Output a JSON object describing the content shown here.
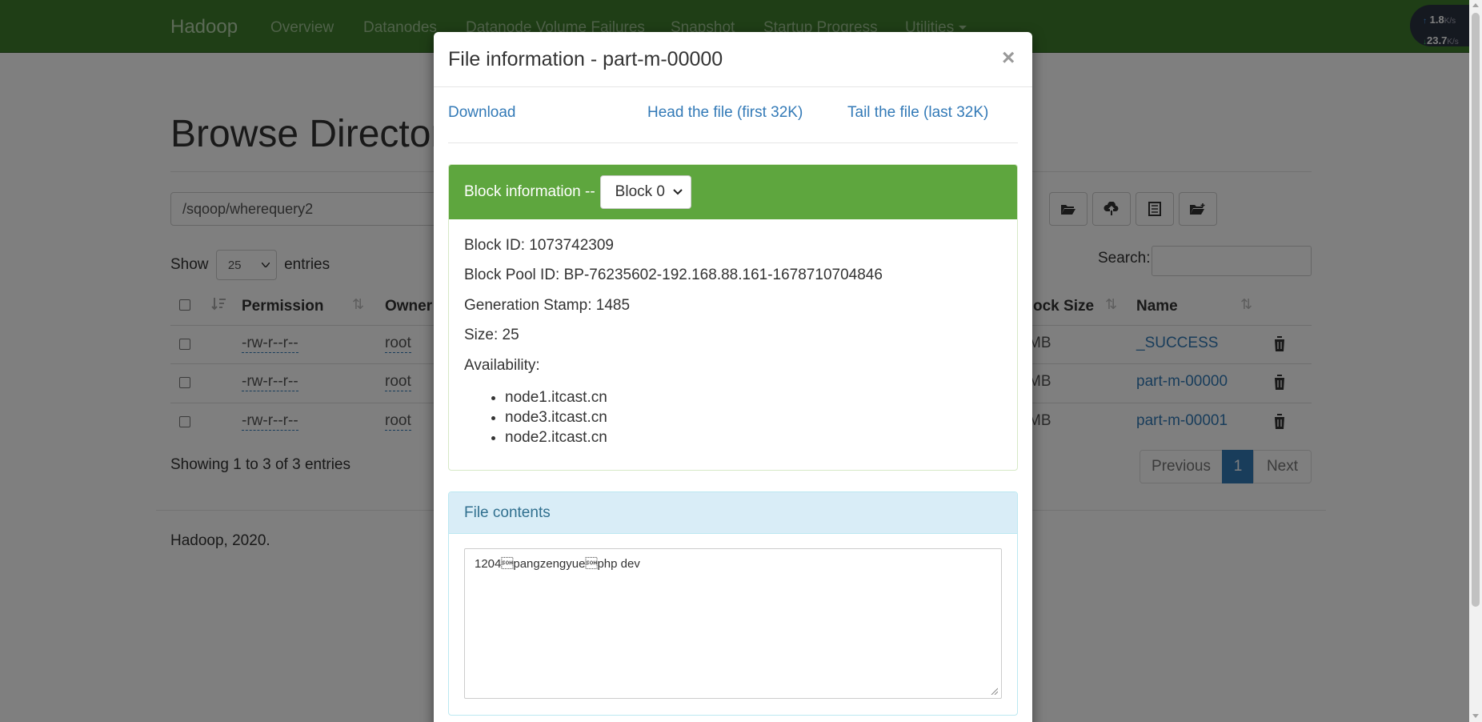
{
  "navbar": {
    "brand": "Hadoop",
    "items": [
      "Overview",
      "Datanodes",
      "Datanode Volume Failures",
      "Snapshot",
      "Startup Progress",
      "Utilities"
    ]
  },
  "netspeed": {
    "up": "1.8",
    "down": "23.7",
    "unit": "K/s"
  },
  "browse": {
    "title": "Browse Directory",
    "path": "/sqoop/wherequery2",
    "show_label": "Show",
    "entries_count": "25",
    "entries_label": "entries",
    "search_label": "Search:",
    "columns": [
      "Permission",
      "Owner",
      "Block Size",
      "Name"
    ],
    "rows": [
      {
        "permission": "-rw-r--r--",
        "owner": "root",
        "block_size": "MB",
        "name": "_SUCCESS"
      },
      {
        "permission": "-rw-r--r--",
        "owner": "root",
        "block_size": "MB",
        "name": "part-m-00000"
      },
      {
        "permission": "-rw-r--r--",
        "owner": "root",
        "block_size": "MB",
        "name": "part-m-00001"
      }
    ],
    "showing": "Showing 1 to 3 of 3 entries",
    "pager": {
      "previous": "Previous",
      "page": "1",
      "next": "Next"
    },
    "footer": "Hadoop, 2020."
  },
  "modal": {
    "title": "File information - part-m-00000",
    "close": "×",
    "links": {
      "download": "Download",
      "head": "Head the file (first 32K)",
      "tail": "Tail the file (last 32K)"
    },
    "block": {
      "heading": "Block information --",
      "selected": "Block 0",
      "block_id": "Block ID: 1073742309",
      "pool_id": "Block Pool ID: BP-76235602-192.168.88.161-1678710704846",
      "generation": "Generation Stamp: 1485",
      "size": "Size: 25",
      "availability_label": "Availability:",
      "nodes": [
        "node1.itcast.cn",
        "node3.itcast.cn",
        "node2.itcast.cn"
      ]
    },
    "file_contents": {
      "heading": "File contents",
      "text": "1204\u0001pangzengyue\u0001php dev"
    }
  }
}
